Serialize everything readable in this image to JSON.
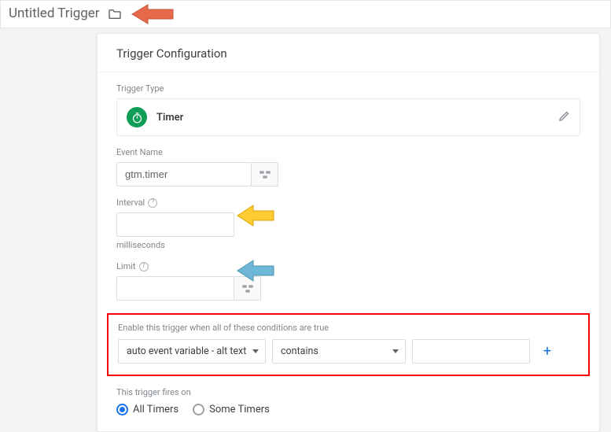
{
  "header": {
    "title": "Untitled Trigger"
  },
  "card": {
    "title": "Trigger Configuration",
    "type_label": "Trigger Type",
    "type_name": "Timer",
    "event_label": "Event Name",
    "event_value": "gtm.timer",
    "interval_label": "Interval",
    "interval_value": "",
    "interval_unit": "milliseconds",
    "limit_label": "Limit",
    "limit_value": "",
    "conditions_label": "Enable this trigger when all of these conditions are true",
    "cond_variable": "auto event variable - alt text",
    "cond_operator": "contains",
    "cond_value": "",
    "fires_label": "This trigger fires on",
    "fires_all": "All Timers",
    "fires_some": "Some Timers",
    "fires_selected": "all"
  }
}
